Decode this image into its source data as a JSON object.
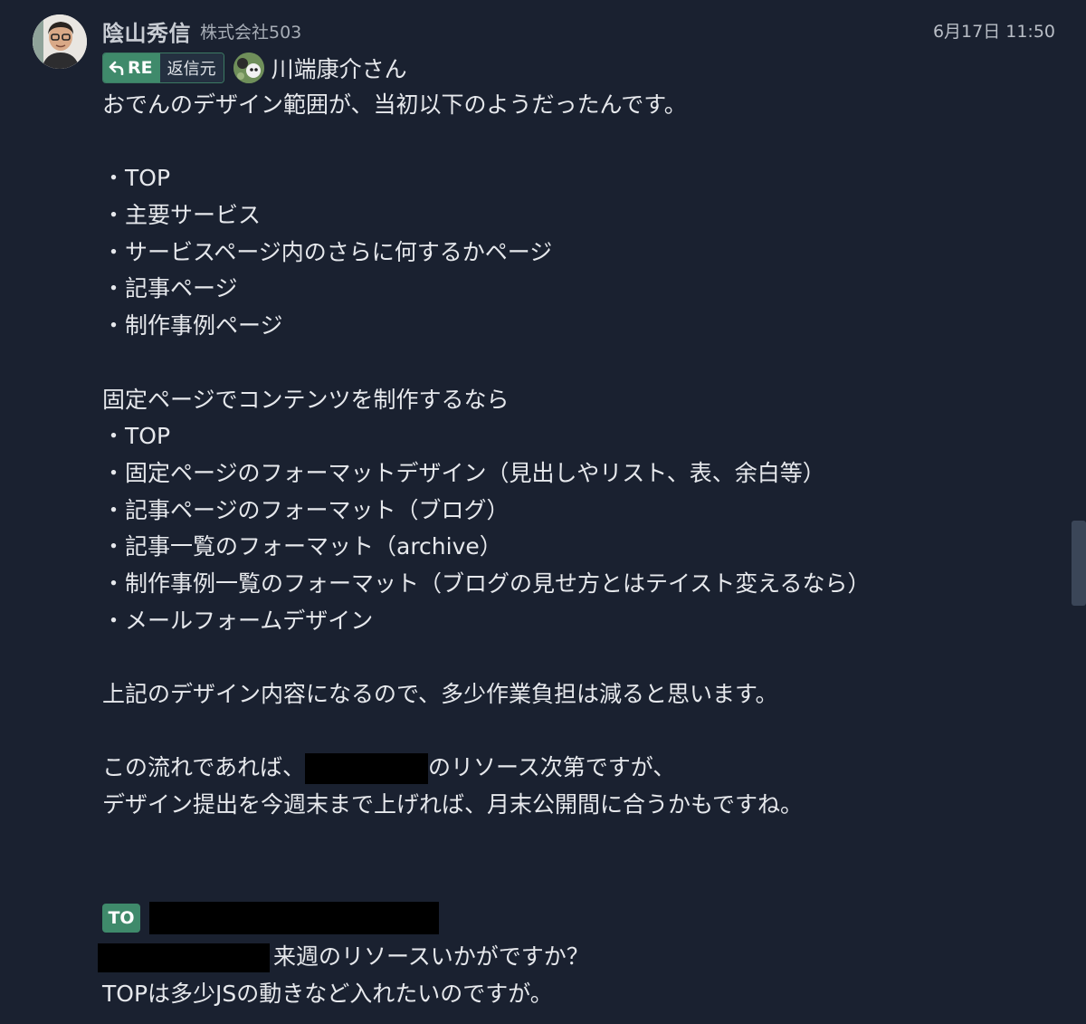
{
  "sender": {
    "name": "陰山秀信",
    "company": "株式会社503"
  },
  "timestamp": "6月17日 11:50",
  "reply": {
    "badge_label": "RE",
    "source_label": "返信元",
    "recipient": "川端康介さん"
  },
  "body": {
    "intro": "おでんのデザイン範囲が、当初以下のようだったんです。",
    "list1": [
      "・TOP",
      "・主要サービス",
      "・サービスページ内のさらに何するかページ",
      "・記事ページ",
      "・制作事例ページ"
    ],
    "fixed_heading": "固定ページでコンテンツを制作するなら",
    "list2": [
      "・TOP",
      "・固定ページのフォーマットデザイン（見出しやリスト、表、余白等）",
      "・記事ページのフォーマット（ブログ）",
      "・記事一覧のフォーマット（archive）",
      "・制作事例一覧のフォーマット（ブログの見せ方とはテイスト変えるなら）",
      "・メールフォームデザイン"
    ],
    "summary": "上記のデザイン内容になるので、多少作業負担は減ると思います。",
    "flow_prefix": "この流れであれば、",
    "flow_suffix": "のリソース次第ですが、",
    "deadline": "デザイン提出を今週末まで上げれば、月末公開間に合うかもですね。"
  },
  "to": {
    "badge_label": "TO",
    "question_suffix": "来週のリソースいかがですか？",
    "request": "TOPは多少JSの動きなど入れたいのですが。"
  },
  "icons": {
    "reply_arrow": "reply-arrow-icon"
  },
  "colors": {
    "background": "#1a2130",
    "accent_green": "#3f8a6b",
    "redaction": "#000000"
  }
}
